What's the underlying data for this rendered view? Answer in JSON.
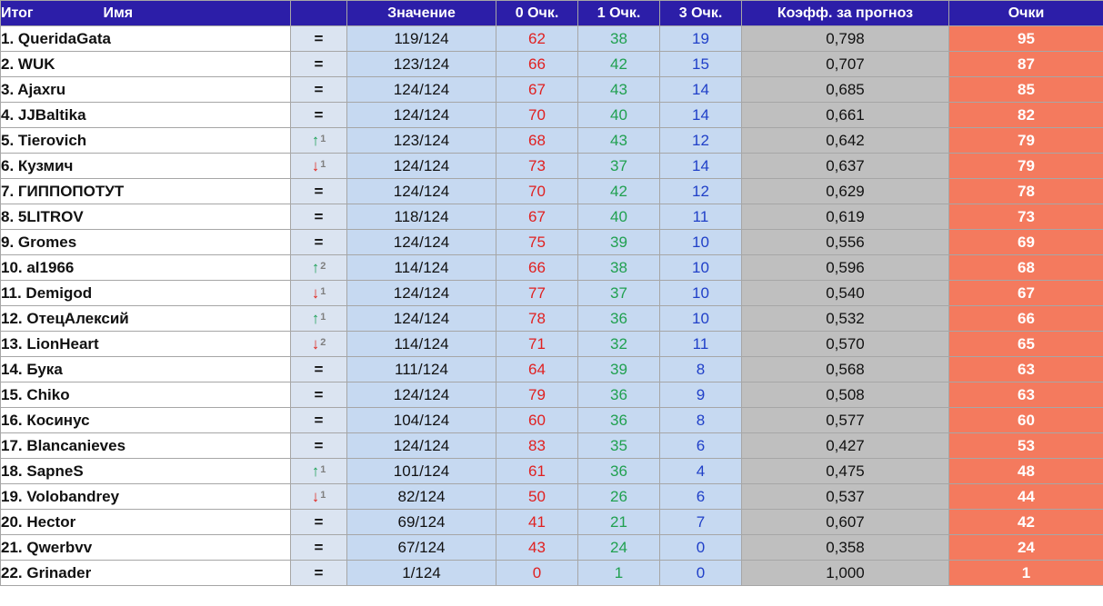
{
  "colors": {
    "header_bg": "#2c1ea8",
    "header_text": "#ffffff",
    "points_bg": "#f47a5e",
    "coef_bg": "#bfbfbf",
    "value_bg": "#c6d9f1",
    "zero_color": "#e02020",
    "one_color": "#20a050",
    "three_color": "#1f3fc8",
    "up_color": "#1aa055",
    "down_color": "#e0241c"
  },
  "header": {
    "rank": "Итог",
    "name": "Имя",
    "value": "Значение",
    "zero": "0 Очк.",
    "one": "1 Очк.",
    "three": "3 Очк.",
    "coef": "Коэфф. за прогноз",
    "points": "Очки"
  },
  "rows": [
    {
      "rank": "1. QueridaGata",
      "dir": "eq",
      "change": "=",
      "value": "119/124",
      "zero": "62",
      "one": "38",
      "three": "19",
      "coef": "0,798",
      "points": "95"
    },
    {
      "rank": "2. WUK",
      "dir": "eq",
      "change": "=",
      "value": "123/124",
      "zero": "66",
      "one": "42",
      "three": "15",
      "coef": "0,707",
      "points": "87"
    },
    {
      "rank": "3. Ajaxru",
      "dir": "eq",
      "change": "=",
      "value": "124/124",
      "zero": "67",
      "one": "43",
      "three": "14",
      "coef": "0,685",
      "points": "85"
    },
    {
      "rank": "4. JJBaltika",
      "dir": "eq",
      "change": "=",
      "value": "124/124",
      "zero": "70",
      "one": "40",
      "three": "14",
      "coef": "0,661",
      "points": "82"
    },
    {
      "rank": "5. Tierovich",
      "dir": "up",
      "change": "1",
      "value": "123/124",
      "zero": "68",
      "one": "43",
      "three": "12",
      "coef": "0,642",
      "points": "79"
    },
    {
      "rank": "6. Кузмич",
      "dir": "down",
      "change": "1",
      "value": "124/124",
      "zero": "73",
      "one": "37",
      "three": "14",
      "coef": "0,637",
      "points": "79"
    },
    {
      "rank": "7. ГИППОПОТУТ",
      "dir": "eq",
      "change": "=",
      "value": "124/124",
      "zero": "70",
      "one": "42",
      "three": "12",
      "coef": "0,629",
      "points": "78"
    },
    {
      "rank": "8. 5LITROV",
      "dir": "eq",
      "change": "=",
      "value": "118/124",
      "zero": "67",
      "one": "40",
      "three": "11",
      "coef": "0,619",
      "points": "73"
    },
    {
      "rank": "9. Gromes",
      "dir": "eq",
      "change": "=",
      "value": "124/124",
      "zero": "75",
      "one": "39",
      "three": "10",
      "coef": "0,556",
      "points": "69"
    },
    {
      "rank": "10. al1966",
      "dir": "up",
      "change": "2",
      "value": "114/124",
      "zero": "66",
      "one": "38",
      "three": "10",
      "coef": "0,596",
      "points": "68"
    },
    {
      "rank": "11. Demigod",
      "dir": "down",
      "change": "1",
      "value": "124/124",
      "zero": "77",
      "one": "37",
      "three": "10",
      "coef": "0,540",
      "points": "67"
    },
    {
      "rank": "12. ОтецАлексий",
      "dir": "up",
      "change": "1",
      "value": "124/124",
      "zero": "78",
      "one": "36",
      "three": "10",
      "coef": "0,532",
      "points": "66"
    },
    {
      "rank": "13. LionHeart",
      "dir": "down",
      "change": "2",
      "value": "114/124",
      "zero": "71",
      "one": "32",
      "three": "11",
      "coef": "0,570",
      "points": "65"
    },
    {
      "rank": "14. Бука",
      "dir": "eq",
      "change": "=",
      "value": "111/124",
      "zero": "64",
      "one": "39",
      "three": "8",
      "coef": "0,568",
      "points": "63"
    },
    {
      "rank": "15. Chiko",
      "dir": "eq",
      "change": "=",
      "value": "124/124",
      "zero": "79",
      "one": "36",
      "three": "9",
      "coef": "0,508",
      "points": "63"
    },
    {
      "rank": "16. Косинус",
      "dir": "eq",
      "change": "=",
      "value": "104/124",
      "zero": "60",
      "one": "36",
      "three": "8",
      "coef": "0,577",
      "points": "60"
    },
    {
      "rank": "17. Blancanieves",
      "dir": "eq",
      "change": "=",
      "value": "124/124",
      "zero": "83",
      "one": "35",
      "three": "6",
      "coef": "0,427",
      "points": "53"
    },
    {
      "rank": "18. SapneS",
      "dir": "up",
      "change": "1",
      "value": "101/124",
      "zero": "61",
      "one": "36",
      "three": "4",
      "coef": "0,475",
      "points": "48"
    },
    {
      "rank": "19. Volobandrey",
      "dir": "down",
      "change": "1",
      "value": "82/124",
      "zero": "50",
      "one": "26",
      "three": "6",
      "coef": "0,537",
      "points": "44"
    },
    {
      "rank": "20. Hector",
      "dir": "eq",
      "change": "=",
      "value": "69/124",
      "zero": "41",
      "one": "21",
      "three": "7",
      "coef": "0,607",
      "points": "42"
    },
    {
      "rank": "21. Qwerbvv",
      "dir": "eq",
      "change": "=",
      "value": "67/124",
      "zero": "43",
      "one": "24",
      "three": "0",
      "coef": "0,358",
      "points": "24"
    },
    {
      "rank": "22. Grinader",
      "dir": "eq",
      "change": "=",
      "value": "1/124",
      "zero": "0",
      "one": "1",
      "three": "0",
      "coef": "1,000",
      "points": "1"
    }
  ]
}
